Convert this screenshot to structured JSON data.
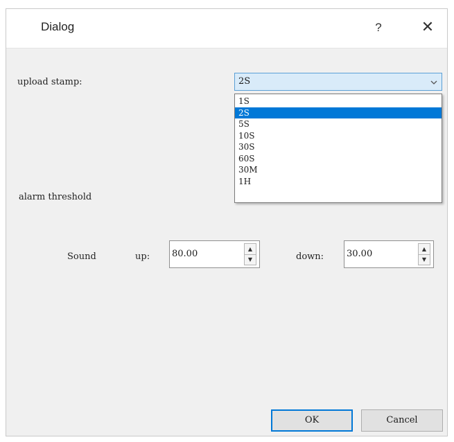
{
  "window": {
    "title": "Dialog",
    "help_label": "?",
    "close_label": "✕"
  },
  "upload": {
    "label": "upload stamp:",
    "selected": "2S",
    "options": [
      "1S",
      "2S",
      "5S",
      "10S",
      "30S",
      "60S",
      "30M",
      "1H"
    ],
    "selected_index": 1
  },
  "alarm": {
    "label": "alarm threshold",
    "sound_label": "Sound",
    "up_label": "up:",
    "up_value": "80.00",
    "down_label": "down:",
    "down_value": "30.00",
    "spin_up_glyph": "▲",
    "spin_down_glyph": "▼"
  },
  "buttons": {
    "ok_label": "OK",
    "cancel_label": "Cancel"
  },
  "colors": {
    "accent": "#0078d7",
    "combo_bg": "#d9ebf9",
    "window_bg": "#f0f0f0"
  }
}
